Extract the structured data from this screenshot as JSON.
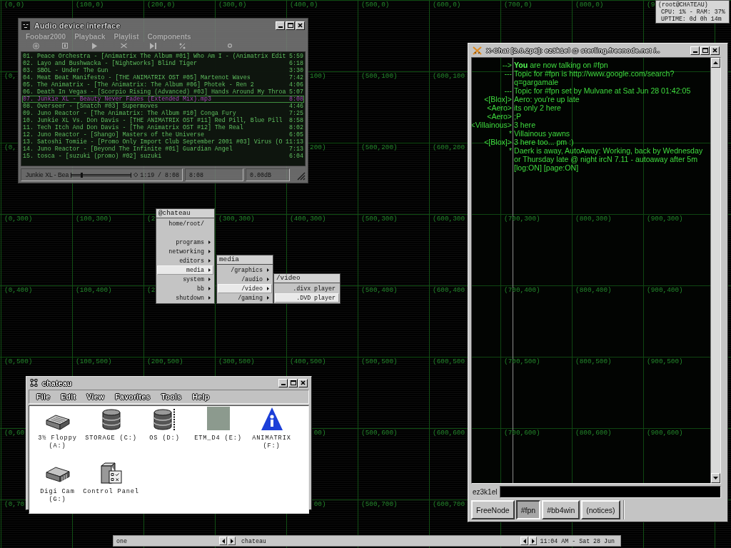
{
  "desktop": {
    "grid": [
      [
        {
          "kind": "label",
          "label": "(0,0)"
        },
        {
          "kind": "label",
          "label": "(100,0)"
        },
        {
          "kind": "label",
          "label": "(200,0)"
        },
        {
          "kind": "label",
          "label": "(300,0)"
        },
        {
          "kind": "label",
          "label": "(400,0)"
        },
        {
          "kind": "label",
          "label": "(500,0)"
        },
        {
          "kind": "label",
          "label": "(600,0)"
        },
        {
          "kind": "label",
          "label": "(700,0)"
        },
        {
          "kind": "label",
          "label": "(800,0)"
        },
        {
          "kind": "label",
          "label": "(9"
        }
      ],
      [
        {
          "kind": "label",
          "label": "(0,"
        },
        {
          "kind": "covered"
        },
        {
          "kind": "covered"
        },
        {
          "kind": "covered"
        },
        {
          "kind": "tail",
          "label": "100)"
        },
        {
          "kind": "label",
          "label": "(500,100)"
        },
        {
          "kind": "label",
          "label": "(600,100"
        },
        {
          "kind": "covered"
        },
        {
          "kind": "covered"
        },
        {
          "kind": "covered"
        }
      ],
      [
        {
          "kind": "label",
          "label": "(0,"
        },
        {
          "kind": "covered"
        },
        {
          "kind": "covered"
        },
        {
          "kind": "covered"
        },
        {
          "kind": "tail",
          "label": "200)"
        },
        {
          "kind": "label",
          "label": "(500,200)"
        },
        {
          "kind": "label",
          "label": "(600,200"
        },
        {
          "kind": "covered"
        },
        {
          "kind": "covered"
        },
        {
          "kind": "covered"
        }
      ],
      [
        {
          "kind": "label",
          "label": "(0,300)"
        },
        {
          "kind": "label",
          "label": "(100,300)"
        },
        {
          "kind": "label",
          "label": "(2"
        },
        {
          "kind": "label",
          "label": "(300,300)"
        },
        {
          "kind": "label",
          "label": "(400,300)"
        },
        {
          "kind": "label",
          "label": "(500,300)"
        },
        {
          "kind": "label",
          "label": "(600,300"
        },
        {
          "kind": "covered"
        },
        {
          "kind": "covered"
        },
        {
          "kind": "covered"
        }
      ],
      [
        {
          "kind": "label",
          "label": "(0,400)"
        },
        {
          "kind": "label",
          "label": "(100,400)"
        },
        {
          "kind": "label",
          "label": "(2"
        },
        {
          "kind": "covered"
        },
        {
          "kind": "covered"
        },
        {
          "kind": "label",
          "label": "(500,400)"
        },
        {
          "kind": "label",
          "label": "(600,400"
        },
        {
          "kind": "covered"
        },
        {
          "kind": "covered"
        },
        {
          "kind": "covered"
        }
      ],
      [
        {
          "kind": "label",
          "label": "(0,500)"
        },
        {
          "kind": "label",
          "label": "(100,500)"
        },
        {
          "kind": "label",
          "label": "(200,500)"
        },
        {
          "kind": "label",
          "label": "(300,500)"
        },
        {
          "kind": "label",
          "label": "(400,500)"
        },
        {
          "kind": "label",
          "label": "(500,500)"
        },
        {
          "kind": "label",
          "label": "(600,500"
        },
        {
          "kind": "covered"
        },
        {
          "kind": "covered"
        },
        {
          "kind": "covered"
        }
      ],
      [
        {
          "kind": "label",
          "label": "(0,60"
        },
        {
          "kind": "covered"
        },
        {
          "kind": "covered"
        },
        {
          "kind": "covered"
        },
        {
          "kind": "tail",
          "label": "00)"
        },
        {
          "kind": "label",
          "label": "(500,600)"
        },
        {
          "kind": "label",
          "label": "(600,600"
        },
        {
          "kind": "covered"
        },
        {
          "kind": "covered"
        },
        {
          "kind": "covered"
        }
      ],
      [
        {
          "kind": "label",
          "label": "(0,70"
        },
        {
          "kind": "covered"
        },
        {
          "kind": "covered"
        },
        {
          "kind": "covered"
        },
        {
          "kind": "tail",
          "label": "00)"
        },
        {
          "kind": "label",
          "label": "(500,700)"
        },
        {
          "kind": "label",
          "label": "(600,700"
        },
        {
          "kind": "covered"
        },
        {
          "kind": "covered"
        },
        {
          "kind": "covered"
        }
      ]
    ]
  },
  "system_monitor": {
    "lines": [
      "(root@CHATEAU)",
      "CPU: 1% - RAM: 37%",
      "UPTIME: 0d 0h 14m"
    ]
  },
  "audio_window": {
    "title": "Audio device interface",
    "menu": [
      "Foobar2000",
      "Playback",
      "Playlist",
      "Components"
    ],
    "playlist": [
      {
        "title": "01. Peace Orchestra - [Animatrix The Album #01] Who Am I - (Animatrix Edit",
        "duration": "5:59",
        "selected": false
      },
      {
        "title": "02. Layo and Bushwacka - [Nightworks] Blind Tiger",
        "duration": "6:18",
        "selected": false
      },
      {
        "title": "03. SBOL - Under The Gun",
        "duration": "3:30",
        "selected": false
      },
      {
        "title": "04. Meat Beat Manifesto - [THE ANIMATRIX OST #05] Martenot Waves",
        "duration": "7:42",
        "selected": false
      },
      {
        "title": "05. The Animatrix - [The Animatrix: The Album #06] Photek - Ren 2",
        "duration": "4:06",
        "selected": false
      },
      {
        "title": "06. Death In Vegas - [Scorpio Rising (Advanced) #03] Hands Around My Throa",
        "duration": "5:07",
        "selected": false
      },
      {
        "title": "07. Junkie XL - Beauty Never Fades (Extended Mix).mp3",
        "duration": "8:08",
        "selected": true
      },
      {
        "title": "08. Overseer - [Snatch #03] Supermoves",
        "duration": "4:46",
        "selected": false
      },
      {
        "title": "09. Juno Reactor - [The Animatrix: The Album #10] Conga Fury",
        "duration": "7:25",
        "selected": false
      },
      {
        "title": "10. Junkie XL Vs. Don Davis - [THE ANIMATRIX OST #11] Red Pill, Blue Pill",
        "duration": "8:58",
        "selected": false
      },
      {
        "title": "11. Tech Itch And Don Davis - [The Animatrix OST #12] The Real",
        "duration": "8:02",
        "selected": false
      },
      {
        "title": "12. Juno Reactor - [Shango] Masters of the Universe",
        "duration": "6:05",
        "selected": false
      },
      {
        "title": "13. Satoshi Tomiie - [Promo Only Import Club September 2001 #03] Virus (O",
        "duration": "11:13",
        "selected": false
      },
      {
        "title": "14. Juno Reactor - [Beyond The Infinite #01] Guardian Angel",
        "duration": "7:13",
        "selected": false
      },
      {
        "title": "15. tosca - [suzuki (promo) #02] suzuki",
        "duration": "6:04",
        "selected": false
      }
    ],
    "status": {
      "track": "Junkie XL - Bea",
      "seek": {
        "level": 0.16
      },
      "time": "1:19 / 8:08",
      "length": "8:08",
      "volume": "0.00dB"
    }
  },
  "menus": [
    {
      "title": "@chateau",
      "items": [
        {
          "label": "home/root/",
          "submenu": false,
          "selected": false,
          "gap_after": true
        },
        {
          "label": "programs",
          "submenu": true,
          "selected": false,
          "gap_after": false
        },
        {
          "label": "networking",
          "submenu": true,
          "selected": false,
          "gap_after": false
        },
        {
          "label": "editors",
          "submenu": true,
          "selected": false,
          "gap_after": false
        },
        {
          "label": "media",
          "submenu": true,
          "selected": true,
          "gap_after": false
        },
        {
          "label": "system",
          "submenu": true,
          "selected": false,
          "gap_after": false
        },
        {
          "label": "bb",
          "submenu": true,
          "selected": false,
          "gap_after": false
        },
        {
          "label": "shutdown",
          "submenu": true,
          "selected": false,
          "gap_after": false
        }
      ]
    },
    {
      "title": "media",
      "items": [
        {
          "label": "/graphics",
          "submenu": true,
          "selected": false,
          "gap_after": false
        },
        {
          "label": "/audio",
          "submenu": true,
          "selected": false,
          "gap_after": false
        },
        {
          "label": "/video",
          "submenu": true,
          "selected": true,
          "gap_after": false
        },
        {
          "label": "/gaming",
          "submenu": true,
          "selected": false,
          "gap_after": false
        }
      ]
    },
    {
      "title": "/video",
      "items": [
        {
          "label": ".divx player",
          "submenu": false,
          "selected": false,
          "gap_after": false
        },
        {
          "label": ".DVD player",
          "submenu": false,
          "selected": true,
          "gap_after": false
        }
      ]
    }
  ],
  "chat_window": {
    "title": "X-Chat [2.0.2p6]: ez3k1el @ sterling.freenode.net /..",
    "backdrop_grid": [
      [
        {
          "kind": "covered"
        },
        {
          "kind": "covered"
        },
        {
          "kind": "covered"
        }
      ],
      [
        {
          "kind": "covered"
        },
        {
          "kind": "covered"
        },
        {
          "kind": "covered"
        }
      ],
      [
        {
          "kind": "label",
          "label": "(700,300)"
        },
        {
          "kind": "label",
          "label": "(800,300)"
        },
        {
          "kind": "label",
          "label": "(900,300)"
        }
      ],
      [
        {
          "kind": "label",
          "label": "(700,400)"
        },
        {
          "kind": "label",
          "label": "(800,400)"
        },
        {
          "kind": "label",
          "label": "(900,400)"
        }
      ],
      [
        {
          "kind": "label",
          "label": "(700,500)"
        },
        {
          "kind": "label",
          "label": "(800,500)"
        },
        {
          "kind": "label",
          "label": "(900,500)"
        }
      ],
      [
        {
          "kind": "label",
          "label": "(700,600)"
        },
        {
          "kind": "label",
          "label": "(800,600)"
        },
        {
          "kind": "label",
          "label": "(900,600)"
        }
      ]
    ],
    "lines": [
      {
        "prefix": "-->",
        "text": "**You** are now talking on #fpn"
      },
      {
        "prefix": "---",
        "text": "Topic for #fpn is http://www.google.com/search?q=gargamale"
      },
      {
        "prefix": "---",
        "text": "Topic for #fpn set by Mulvane at Sat Jun 28 01:42:05"
      },
      {
        "prefix": "<[Blox]>",
        "text": "Aero: you're up late"
      },
      {
        "prefix": "<Aero>",
        "text": "its only 2 here"
      },
      {
        "prefix": "<Aero>",
        "text": ";P"
      },
      {
        "prefix": "<Villainous>",
        "text": "3 here"
      },
      {
        "prefix": "*",
        "text": "Villainous yawns"
      },
      {
        "prefix": "<[Blox]>",
        "text": "3 here too... pm :)"
      },
      {
        "prefix": "*",
        "text": "Daerk is away, AutoAway: Working, back by Wednesday or Thursday late @ night ircN 7.11 - autoaway after 5m [log:ON] [page:ON]"
      }
    ],
    "nick": "ez3k1el",
    "tabs": [
      {
        "label": "FreeNode",
        "selected": false
      },
      {
        "label": "#fpn",
        "selected": true
      },
      {
        "label": "#bb4win",
        "selected": false
      },
      {
        "label": "(notices)",
        "selected": false
      }
    ]
  },
  "file_window": {
    "title": "chateau",
    "menu": [
      "File",
      "Edit",
      "View",
      "Favorites",
      "Tools",
      "Help"
    ],
    "items": [
      {
        "kind": "floppy",
        "lines": [
          "3½ Floppy",
          "(A:)"
        ]
      },
      {
        "kind": "disk",
        "lines": [
          "STORAGE (C:)"
        ]
      },
      {
        "kind": "system_disk",
        "lines": [
          "OS (D:)"
        ]
      },
      {
        "kind": "photo",
        "lines": [
          "ETM_D4 (E:)"
        ]
      },
      {
        "kind": "logo",
        "lines": [
          "ANIMATRIX",
          "(F:)"
        ]
      },
      {
        "kind": "camera",
        "lines": [
          "Digi Cam",
          "(G:)"
        ]
      },
      {
        "kind": "control_panel",
        "lines": [
          "Control Panel"
        ]
      }
    ]
  },
  "taskbar": {
    "workspace": "one",
    "window": "chateau",
    "clock": "11:04 AM - Sat 28 Jun"
  }
}
